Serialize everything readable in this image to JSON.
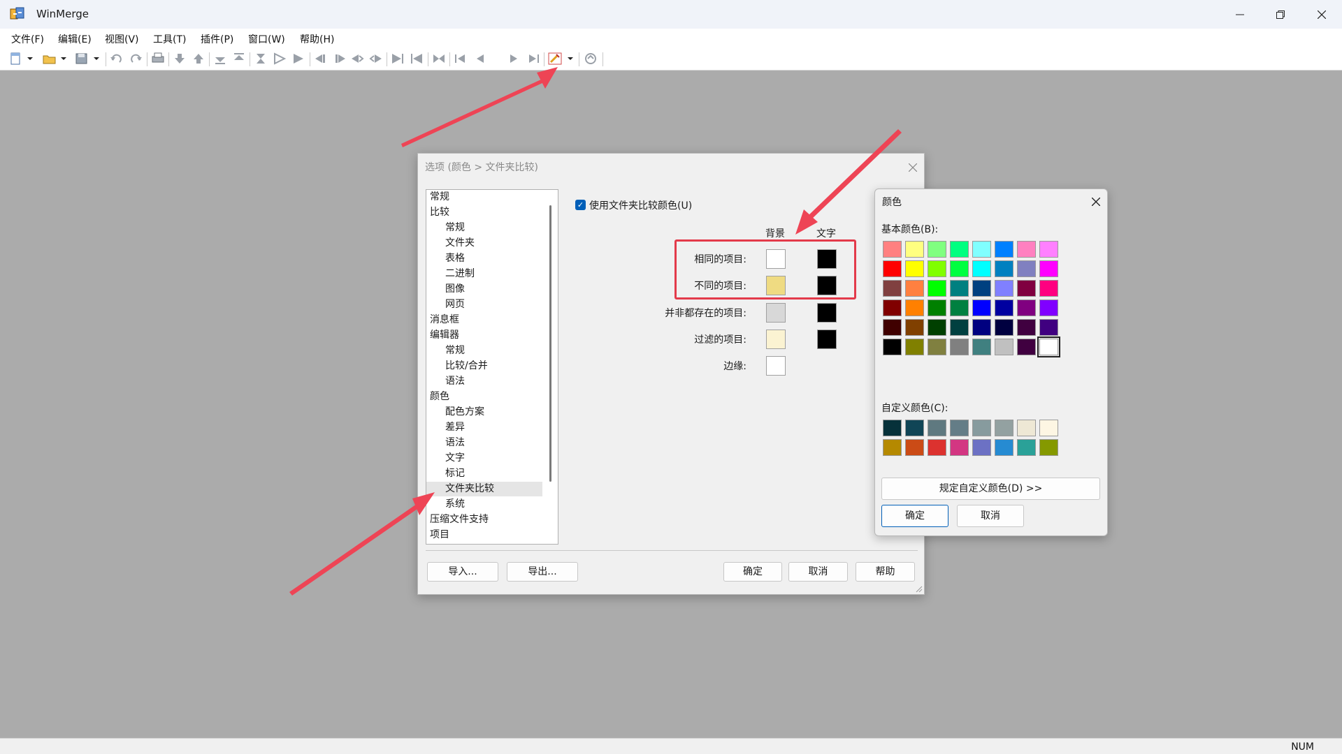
{
  "app": {
    "title": "WinMerge",
    "minimize": "—",
    "maximize": "❐",
    "close": "✕"
  },
  "menu": [
    "文件(F)",
    "编辑(E)",
    "视图(V)",
    "工具(T)",
    "插件(P)",
    "窗口(W)",
    "帮助(H)"
  ],
  "status": {
    "num": "NUM"
  },
  "options_dialog": {
    "title": "选项 (颜色 > 文件夹比较)",
    "tree": [
      "常规",
      "比较",
      "常规",
      "文件夹",
      "表格",
      "二进制",
      "图像",
      "网页",
      "消息框",
      "编辑器",
      "常规",
      "比较/合并",
      "语法",
      "颜色",
      "配色方案",
      "差异",
      "语法",
      "文字",
      "标记",
      "文件夹比较",
      "系统",
      "压缩文件支持",
      "项目"
    ],
    "checkbox": "使用文件夹比较颜色(U)",
    "col_bg": "背景",
    "col_text": "文字",
    "rows": [
      {
        "label": "相同的项目:",
        "bg": "#ffffff",
        "text": "#000000"
      },
      {
        "label": "不同的项目:",
        "bg": "#efdb82",
        "text": "#000000"
      },
      {
        "label": "并非都存在的项目:",
        "bg": "#d8d8d8",
        "text": "#000000"
      },
      {
        "label": "过滤的项目:",
        "bg": "#fbf3d2",
        "text": "#000000"
      },
      {
        "label": "边缘:",
        "bg": "#ffffff",
        "text": null
      }
    ],
    "buttons": {
      "import": "导入...",
      "export": "导出...",
      "ok": "确定",
      "cancel": "取消",
      "help": "帮助"
    }
  },
  "color_dialog": {
    "title": "颜色",
    "basic_label": "基本颜色(B):",
    "custom_label": "自定义颜色(C):",
    "define_button": "规定自定义颜色(D) >>",
    "ok": "确定",
    "cancel": "取消",
    "basic_colors": [
      "#ff8080",
      "#ffff80",
      "#80ff80",
      "#00ff80",
      "#80ffff",
      "#0080ff",
      "#ff80c0",
      "#ff80ff",
      "#ff0000",
      "#ffff00",
      "#80ff00",
      "#00ff40",
      "#00ffff",
      "#0080c0",
      "#8080c0",
      "#ff00ff",
      "#804040",
      "#ff8040",
      "#00ff00",
      "#008080",
      "#004080",
      "#8080ff",
      "#800040",
      "#ff0080",
      "#800000",
      "#ff8000",
      "#008000",
      "#008040",
      "#0000ff",
      "#0000a0",
      "#800080",
      "#8000ff",
      "#400000",
      "#804000",
      "#004000",
      "#004040",
      "#000080",
      "#000040",
      "#400040",
      "#400080",
      "#000000",
      "#808000",
      "#808040",
      "#808080",
      "#408080",
      "#c0c0c0",
      "#400040",
      "#ffffff"
    ],
    "custom_colors": [
      "#06313a",
      "#104556",
      "#5f7980",
      "#647d87",
      "#879b9e",
      "#93a1a1",
      "#eee8d5",
      "#fdf6e3",
      "#b58900",
      "#cb4b16",
      "#dc322f",
      "#d33682",
      "#6c71c4",
      "#268bd2",
      "#2aa198",
      "#859900"
    ]
  }
}
